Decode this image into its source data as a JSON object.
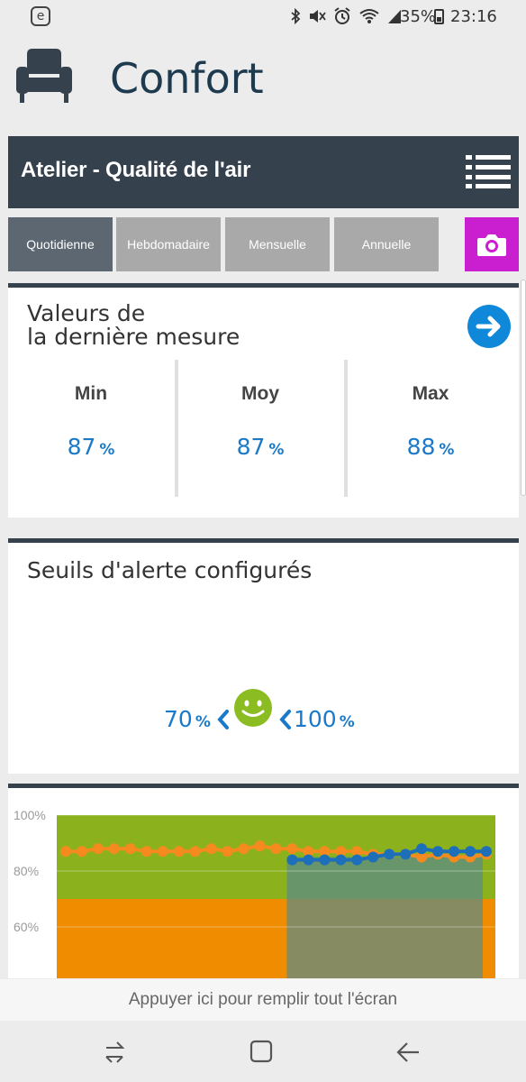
{
  "status_bar": {
    "app_badge": "e",
    "battery_text": "35%",
    "time": "23:16",
    "icons": [
      "bluetooth-icon",
      "mute-icon",
      "alarm-icon",
      "wifi-icon",
      "signal-icon"
    ]
  },
  "header": {
    "title": "Confort",
    "icon": "armchair-icon"
  },
  "title_bar": {
    "label": "Atelier - Qualité de l'air",
    "menu_icon": "list-menu-icon"
  },
  "tabs": [
    {
      "label": "Quotidienne",
      "active": true
    },
    {
      "label": "Hebdomadaire",
      "active": false
    },
    {
      "label": "Mensuelle",
      "active": false
    },
    {
      "label": "Annuelle",
      "active": false
    }
  ],
  "camera_icon": "camera-icon",
  "last_measure": {
    "title_line1": "Valeurs de",
    "title_line2": "la dernière mesure",
    "arrow_icon": "arrow-right-circle-icon",
    "columns": [
      {
        "label": "Min",
        "value": "87",
        "unit": "%"
      },
      {
        "label": "Moy",
        "value": "87",
        "unit": "%"
      },
      {
        "label": "Max",
        "value": "88",
        "unit": "%"
      }
    ]
  },
  "thresholds": {
    "title": "Seuils d'alerte configurés",
    "low": "70",
    "high": "100",
    "unit": "%",
    "less_than": "<",
    "icon": "smiley-face-icon"
  },
  "chart_data": {
    "type": "line",
    "ylim": [
      40,
      100
    ],
    "yticks": [
      "100%",
      "80%",
      "60%"
    ],
    "zones": [
      {
        "from": 70,
        "to": 100,
        "color": "#8bb21c"
      },
      {
        "from": 40,
        "to": 70,
        "color": "#f08c00"
      }
    ],
    "series": [
      {
        "color": "#f58a1f",
        "values": [
          87,
          87,
          88,
          88,
          88,
          87,
          87,
          87,
          87,
          88,
          87,
          88,
          89,
          88,
          88,
          87,
          87,
          87,
          87,
          86,
          86,
          86,
          85,
          86,
          85,
          85,
          86
        ]
      },
      {
        "color": "#1c6fb8",
        "values": [
          84,
          84,
          84,
          84,
          84,
          85,
          86,
          86,
          88,
          87,
          87,
          87,
          87
        ]
      }
    ],
    "overlay_color": "#5a8a8c"
  },
  "fill_bar": {
    "label": "Appuyer ici pour remplir tout l'écran"
  },
  "nav_bar": {
    "icons": [
      "recent-apps-icon",
      "home-icon",
      "back-icon"
    ]
  }
}
